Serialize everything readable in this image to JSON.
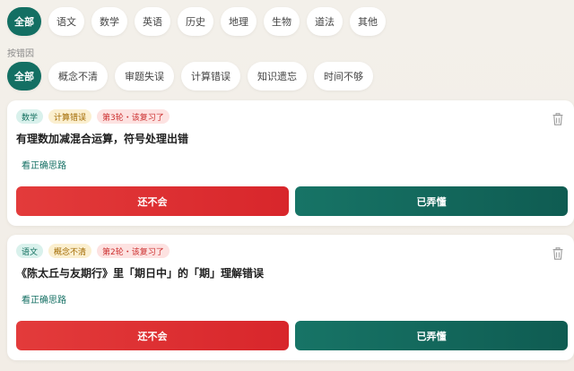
{
  "subjects": [
    "全部",
    "语文",
    "数学",
    "英语",
    "历史",
    "地理",
    "生物",
    "道法",
    "其他"
  ],
  "reason_label": "按错因",
  "reasons": [
    "全部",
    "概念不清",
    "审题失误",
    "计算错误",
    "知识遗忘",
    "时间不够"
  ],
  "cards": [
    {
      "subject": "数学",
      "reason": "计算错误",
      "round": "第3轮・该复习了",
      "question": "有理数加减混合运算，符号处理出错",
      "hint": "看正确思路",
      "dont_know": "还不会",
      "understood": "已弄懂"
    },
    {
      "subject": "语文",
      "reason": "概念不清",
      "round": "第2轮・该复习了",
      "question": "《陈太丘与友期行》里「期日中」的「期」理解错误",
      "hint": "看正确思路",
      "dont_know": "还不会",
      "understood": "已弄懂"
    }
  ],
  "colors": {
    "accent": "#136f63",
    "danger": "#dc2f2f"
  }
}
